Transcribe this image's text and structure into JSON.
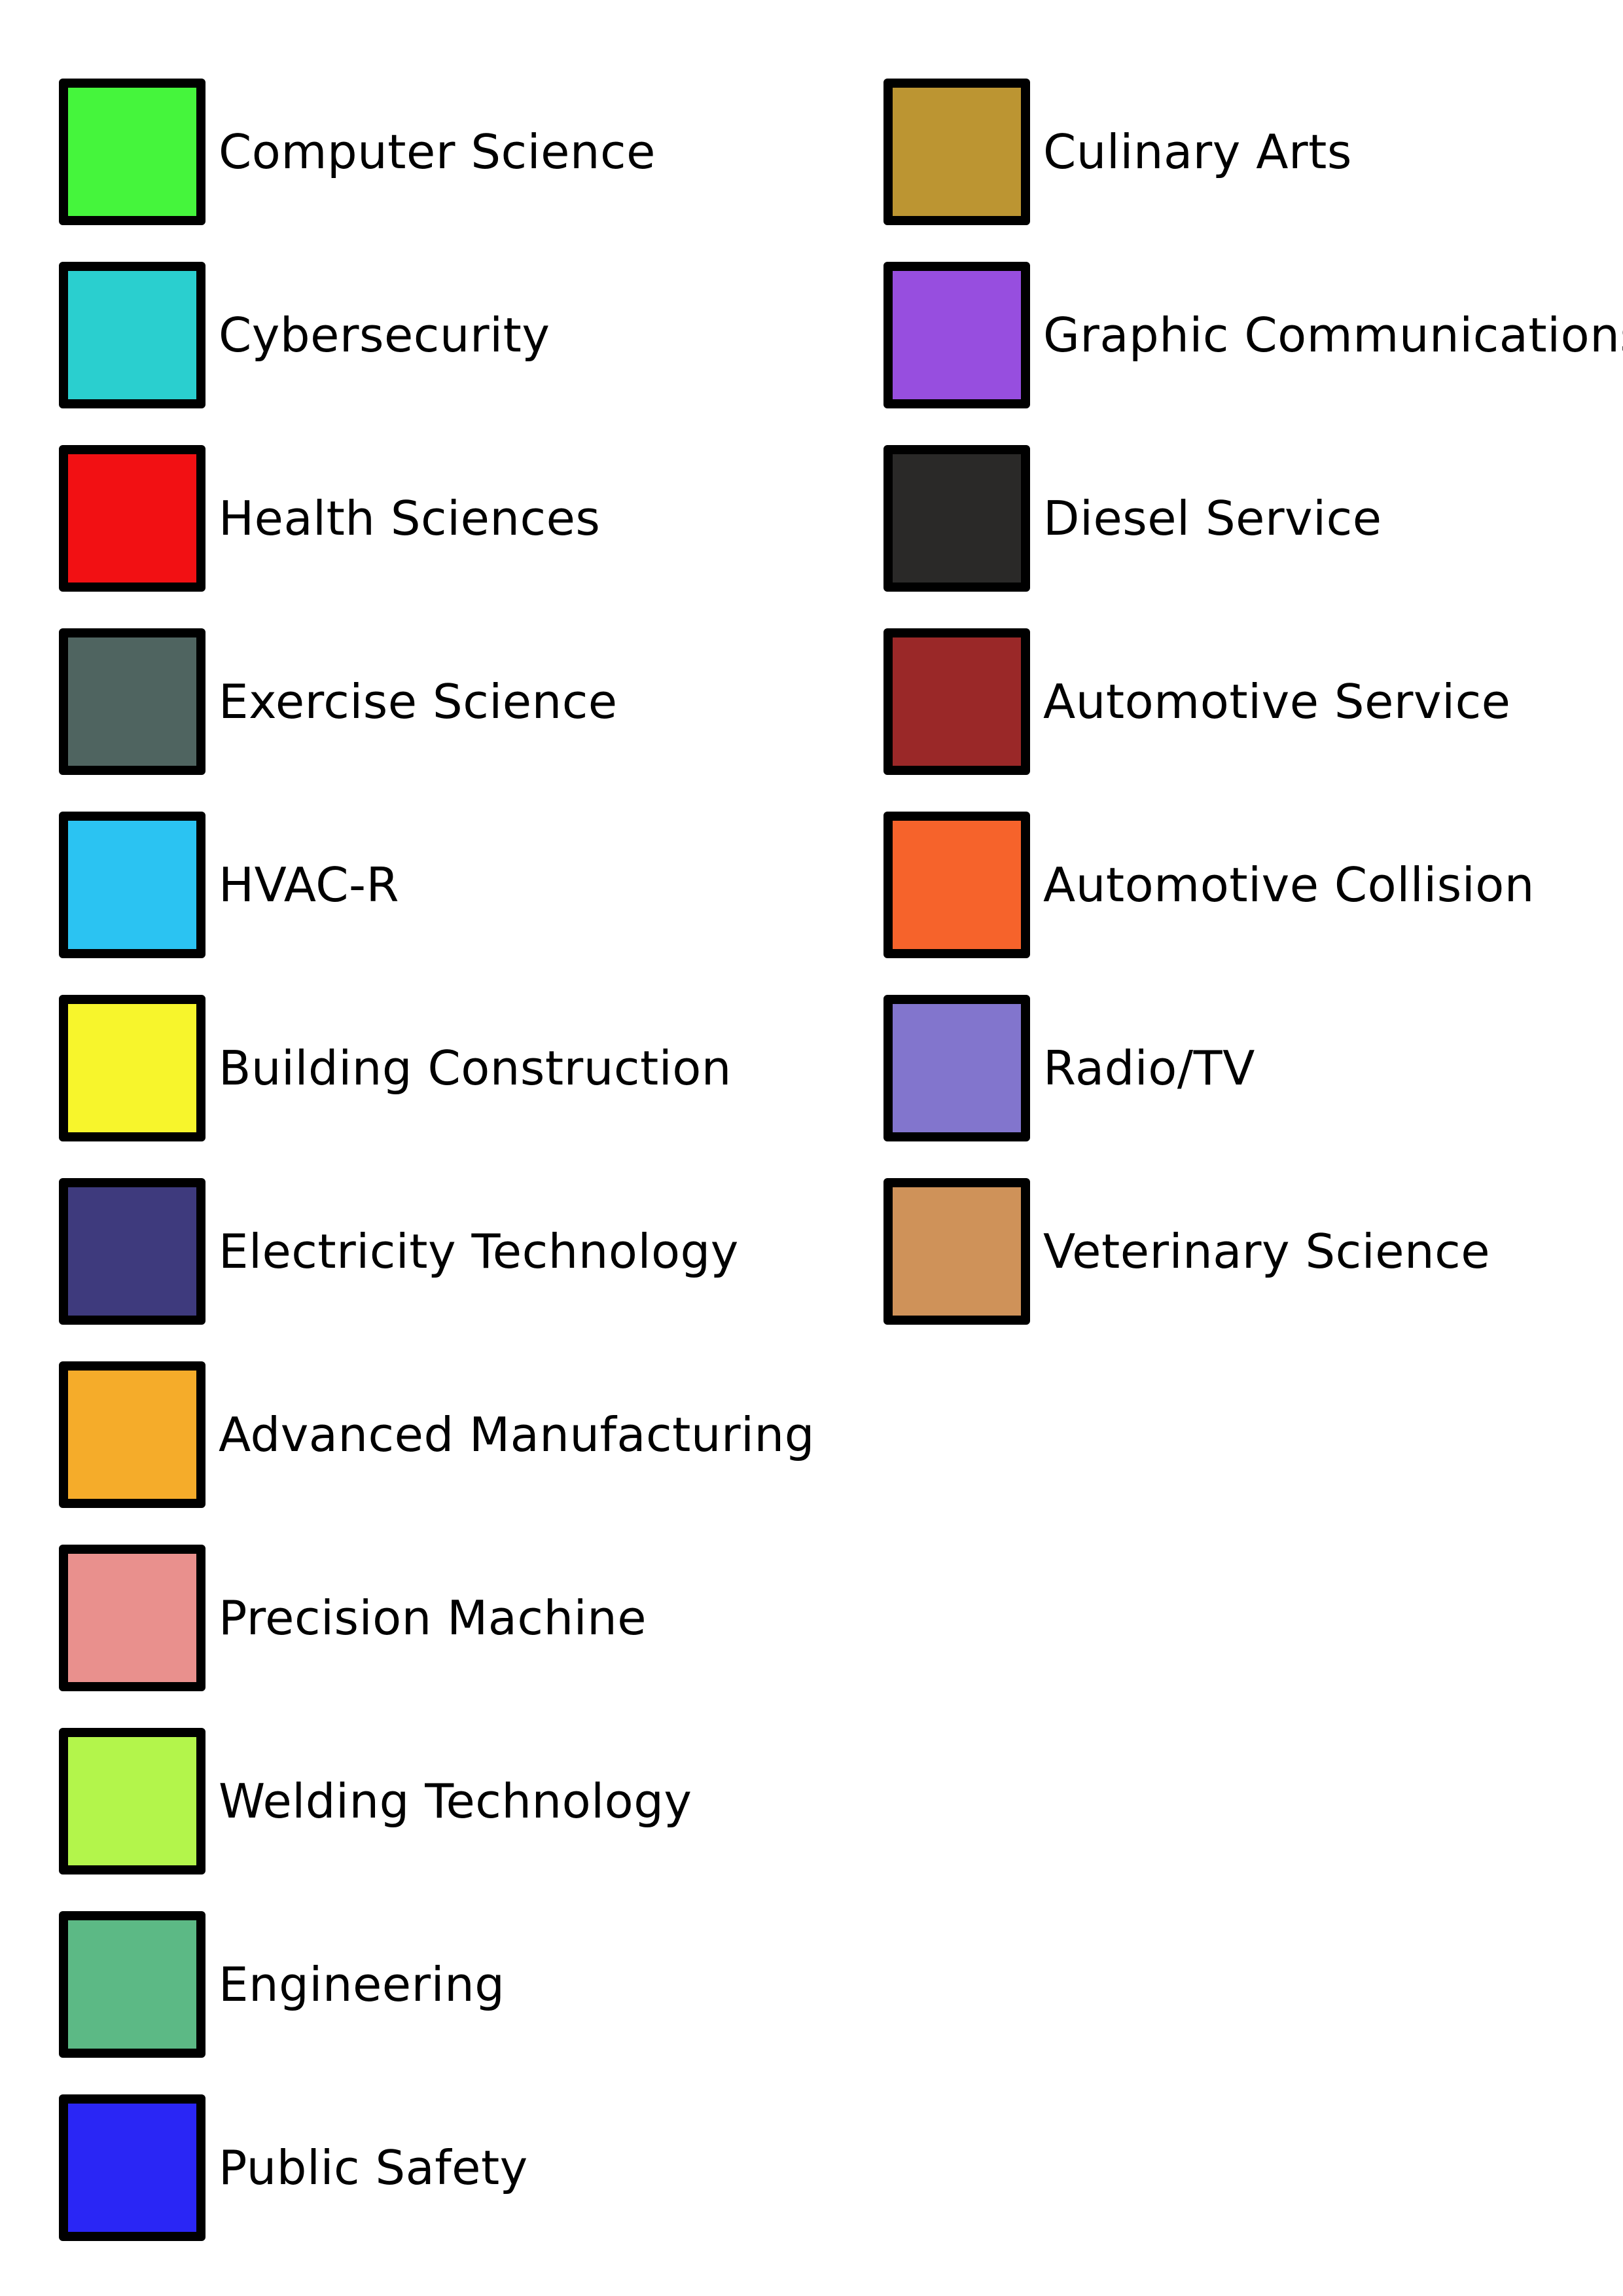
{
  "legend": {
    "left_items": [
      {
        "label": "Computer Science",
        "color": "#45F53C"
      },
      {
        "label": "Cybersecurity",
        "color": "#2ACFCF"
      },
      {
        "label": "Health Sciences",
        "color": "#F21013"
      },
      {
        "label": "Exercise Science",
        "color": "#4F6460"
      },
      {
        "label": "HVAC-R",
        "color": "#2BC3F2"
      },
      {
        "label": "Building Construction",
        "color": "#F7F52C"
      },
      {
        "label": "Electricity Technology",
        "color": "#3E3A7D"
      },
      {
        "label": "Advanced Manufacturing",
        "color": "#F5AC2A"
      },
      {
        "label": "Precision Machine",
        "color": "#E9908D"
      },
      {
        "label": "Welding Technology",
        "color": "#B3F54B"
      },
      {
        "label": "Engineering",
        "color": "#5CB985"
      },
      {
        "label": "Public Safety",
        "color": "#2A26F5"
      }
    ],
    "right_items": [
      {
        "label": "Culinary Arts",
        "color": "#BC9532"
      },
      {
        "label": "Graphic Communications",
        "color": "#974EDF"
      },
      {
        "label": "Diesel Service",
        "color": "#2A2928"
      },
      {
        "label": "Automotive Service",
        "color": "#9A2828"
      },
      {
        "label": "Automotive Collision",
        "color": "#F6632B"
      },
      {
        "label": "Radio/TV",
        "color": "#8275CD"
      },
      {
        "label": "Veterinary Science",
        "color": "#CF9259"
      }
    ]
  }
}
